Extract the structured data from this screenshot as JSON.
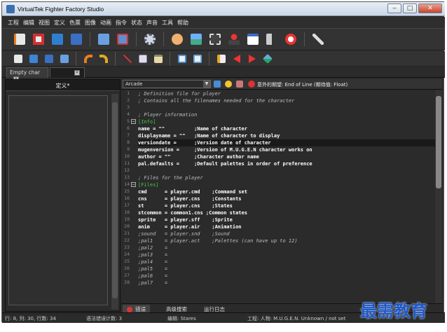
{
  "window": {
    "title": "VirtualTek Fighter Factory Studio",
    "minimize": "‒",
    "maximize": "□",
    "close": "✕"
  },
  "menu": [
    "工程",
    "编辑",
    "视图",
    "定义",
    "色票",
    "图像",
    "动画",
    "指令",
    "状态",
    "声音",
    "工具",
    "帮助"
  ],
  "toolbar1": [
    "new-file-icon",
    "close-file-icon",
    "open-folder-icon",
    "save-icon",
    "save-as-icon",
    "save-all-icon",
    "settings-gear-icon",
    "characters-icon",
    "image-icon",
    "animation-film-icon",
    "joystick-icon",
    "state-window-icon",
    "sound-speaker-icon",
    "help-lifebuoy-icon",
    "tools-wrench-icon"
  ],
  "toolbar2": [
    "new-doc-icon",
    "open-doc-icon",
    "save-doc-icon",
    "save-all-doc-icon",
    "undo-icon",
    "redo-icon",
    "cut-icon",
    "copy-icon",
    "paste-icon",
    "find-icon",
    "replace-icon",
    "go-to-icon",
    "prev-error-icon",
    "next-error-icon",
    "run-check-icon"
  ],
  "doc_tabs": [
    {
      "label": "Empty char",
      "close": "✕"
    },
    {
      "label": "",
      "close": "✕"
    }
  ],
  "left_panel": {
    "title": "定义*"
  },
  "editor": {
    "combo_value": "Arcade",
    "error_message": "意外的期望: End of Line (期待值: Float)"
  },
  "code": {
    "line_numbers": [
      "1",
      "2",
      "3",
      "4",
      "5",
      "6",
      "7",
      "8",
      "9",
      "10",
      "11",
      "12",
      "13",
      "14",
      "15",
      "16",
      "17",
      "18",
      "19",
      "20",
      "21",
      "22",
      "23",
      "24",
      "25",
      "26",
      "27",
      "28"
    ],
    "lines": [
      "; Definition file for player",
      "; Contains all the filenames needed for the character",
      "",
      "; Player information",
      "[Info]",
      "name = \"\"          ;Name of character",
      "displayname = \"\"   ;Name of character to display",
      "versiondate =      ;Version date of character",
      "mugenversion =     ;Version of M.U.G.E.N character works on",
      "author = \"\"        ;Character author name",
      "pal.defaults =     ;Default palettes in order of preference",
      "",
      "; Files for the player",
      "[Files]",
      "cmd      = player.cmd    ;Command set",
      "cns      = player.cns    ;Constants",
      "st       = player.cns    ;States",
      "stcommon = common1.cns ;Common states",
      "sprite   = player.sff    ;Sprite",
      "anim     = player.air    ;Animation",
      ";sound   = player.snd    ;Sound",
      ";pal1    = player.act    ;Palettes (can have up to 12)",
      ";pal2    =",
      ";pal3    =",
      ";pal4    =",
      ";pal5    =",
      ";pal6    =",
      ";pal7    ="
    ]
  },
  "bottom_tabs": [
    "错误",
    "高级搜索",
    "运行日志"
  ],
  "status": {
    "position": "行: 8, 列: 30, 行数: 34",
    "syntax_errors": "语法错误计数: 3",
    "edit_mode": "编辑: Stares",
    "project": "工程: 人物: M.U.G.E.N.  Unknown / not set"
  },
  "watermark": "最需教育"
}
